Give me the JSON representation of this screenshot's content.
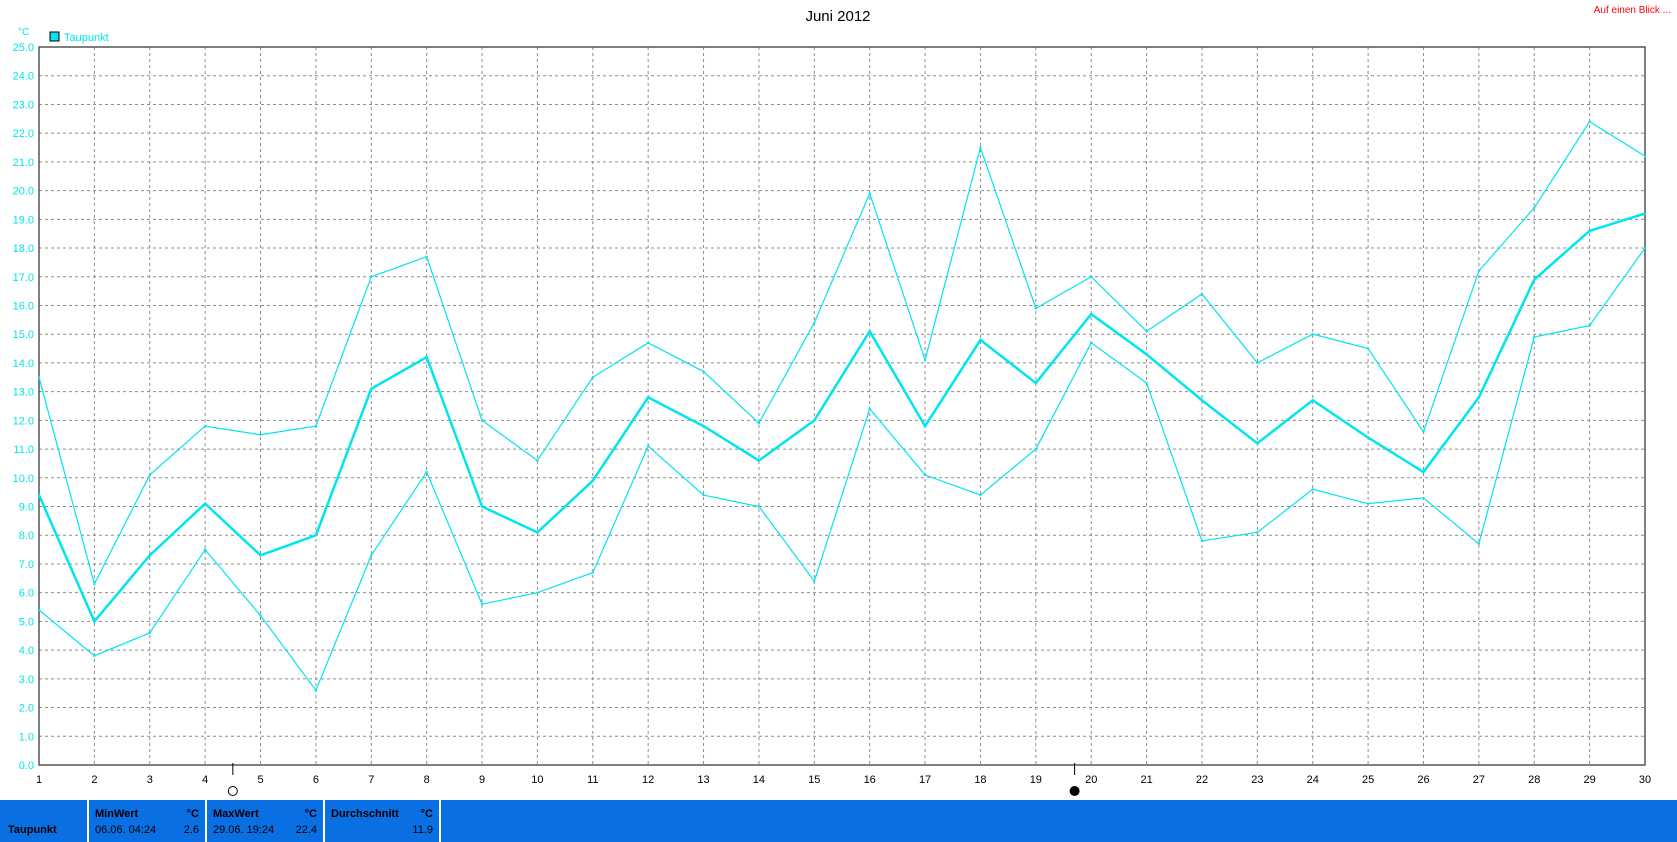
{
  "header": {
    "link_label": "Auf einen Blick ..."
  },
  "chart_data": {
    "type": "line",
    "title": "Juni 2012",
    "unit": "°C",
    "legend": [
      {
        "label": "Taupunkt",
        "color": "#00e5ee"
      }
    ],
    "legend_position": "top-left",
    "x": [
      1,
      2,
      3,
      4,
      5,
      6,
      7,
      8,
      9,
      10,
      11,
      12,
      13,
      14,
      15,
      16,
      17,
      18,
      19,
      20,
      21,
      22,
      23,
      24,
      25,
      26,
      27,
      28,
      29,
      30
    ],
    "ylim": [
      0,
      25
    ],
    "yticks": [
      "0.0",
      "1.0",
      "2.0",
      "3.0",
      "4.0",
      "5.0",
      "6.0",
      "7.0",
      "8.0",
      "9.0",
      "10.0",
      "11.0",
      "12.0",
      "13.0",
      "14.0",
      "15.0",
      "16.0",
      "17.0",
      "18.0",
      "19.0",
      "20.0",
      "21.0",
      "22.0",
      "23.0",
      "24.0",
      "25.0"
    ],
    "grid": true,
    "color": "#00e5ee",
    "series": [
      {
        "role": "max",
        "values": [
          13.5,
          6.3,
          10.1,
          11.8,
          11.5,
          11.8,
          17.0,
          17.7,
          12.0,
          10.6,
          13.5,
          14.7,
          13.7,
          11.9,
          15.4,
          19.9,
          14.1,
          21.5,
          15.9,
          17.0,
          15.1,
          16.4,
          14.0,
          15.0,
          14.5,
          11.6,
          17.2,
          19.4,
          22.4,
          21.2
        ]
      },
      {
        "role": "avg",
        "values": [
          9.4,
          5.0,
          7.3,
          9.1,
          7.3,
          8.0,
          13.1,
          14.2,
          9.0,
          8.1,
          9.9,
          12.8,
          11.8,
          10.6,
          12.0,
          15.1,
          11.8,
          14.8,
          13.3,
          15.7,
          14.3,
          12.7,
          11.2,
          12.7,
          11.4,
          10.2,
          12.8,
          16.9,
          18.6,
          19.2
        ]
      },
      {
        "role": "min",
        "values": [
          5.4,
          3.8,
          4.6,
          7.5,
          5.2,
          2.6,
          7.3,
          10.2,
          5.6,
          6.0,
          6.7,
          11.1,
          9.4,
          9.0,
          6.4,
          12.4,
          10.1,
          9.4,
          11.0,
          14.7,
          13.3,
          7.8,
          8.1,
          9.6,
          9.1,
          9.3,
          7.7,
          14.9,
          15.3,
          18.0
        ]
      }
    ],
    "moon_markers": [
      {
        "x": 4.5,
        "phase": "new-moon"
      },
      {
        "x": 19.7,
        "phase": "full-moon"
      }
    ]
  },
  "summary": {
    "row_label": "Taupunkt",
    "unit": "°C",
    "cells": [
      {
        "head": "MinWert",
        "date": "06.06.  04:24",
        "value": "2.6"
      },
      {
        "head": "MaxWert",
        "date": "29.06.  19:24",
        "value": "22.4"
      },
      {
        "head": "Durchschnitt",
        "date": "",
        "value": "11.9"
      }
    ]
  }
}
